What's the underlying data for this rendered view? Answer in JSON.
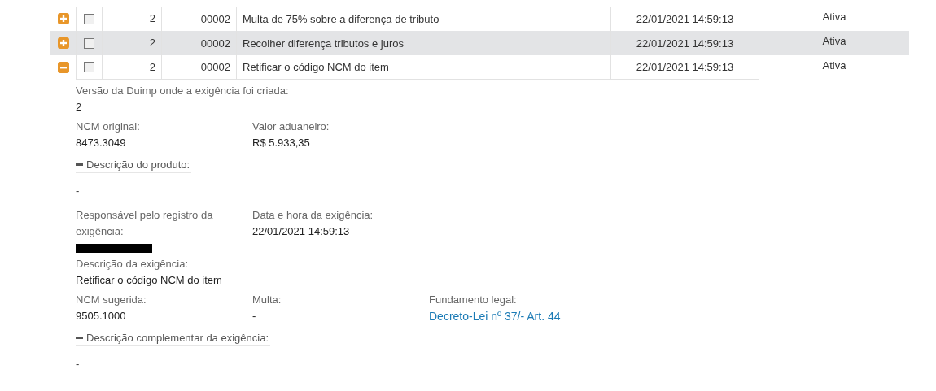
{
  "requirements": {
    "rows": [
      {
        "expanded": false,
        "checked": false,
        "highlighted": false,
        "version": "2",
        "code": "00002",
        "description": "Multa de 75% sobre a diferença de tributo",
        "datetime": "22/01/2021 14:59:13",
        "status": "Ativa"
      },
      {
        "expanded": false,
        "checked": false,
        "highlighted": true,
        "version": "2",
        "code": "00002",
        "description": "Recolher diferença tributos e juros",
        "datetime": "22/01/2021 14:59:13",
        "status": "Ativa"
      },
      {
        "expanded": true,
        "checked": false,
        "highlighted": false,
        "version": "2",
        "code": "00002",
        "description": "Retificar o código NCM do item",
        "datetime": "22/01/2021 14:59:13",
        "status": "Ativa"
      }
    ]
  },
  "details": [
    {
      "kind": "fields",
      "fields": [
        {
          "label": "Versão da Duimp onde a exigência foi criada:",
          "value": "2"
        }
      ]
    },
    {
      "kind": "fields",
      "fields": [
        {
          "label": "NCM original:",
          "value": "8473.3049"
        },
        {
          "label": "Valor aduaneiro:",
          "value": "R$ 5.933,35"
        }
      ]
    },
    {
      "kind": "collapsible",
      "label": "Descrição do produto:",
      "expanded": true,
      "value": "-"
    },
    {
      "kind": "fields",
      "fields": [
        {
          "label": "Responsável pelo registro da exigência:",
          "redacted": true
        },
        {
          "label": "Data e hora da exigência:",
          "value": "22/01/2021 14:59:13"
        }
      ]
    },
    {
      "kind": "fields",
      "fields": [
        {
          "label": "Descrição da exigência:",
          "value": "Retificar o código NCM do item"
        }
      ]
    },
    {
      "kind": "fields",
      "fields": [
        {
          "label": "NCM sugerida:",
          "value": "9505.1000"
        },
        {
          "label": "Multa:",
          "value": "-"
        },
        {
          "label": "Fundamento legal:",
          "value": "Decreto-Lei nº 37/- Art. 44",
          "link": true
        }
      ]
    },
    {
      "kind": "collapsible",
      "label": "Descrição complementar da exigência:",
      "expanded": true,
      "value": "-"
    }
  ]
}
